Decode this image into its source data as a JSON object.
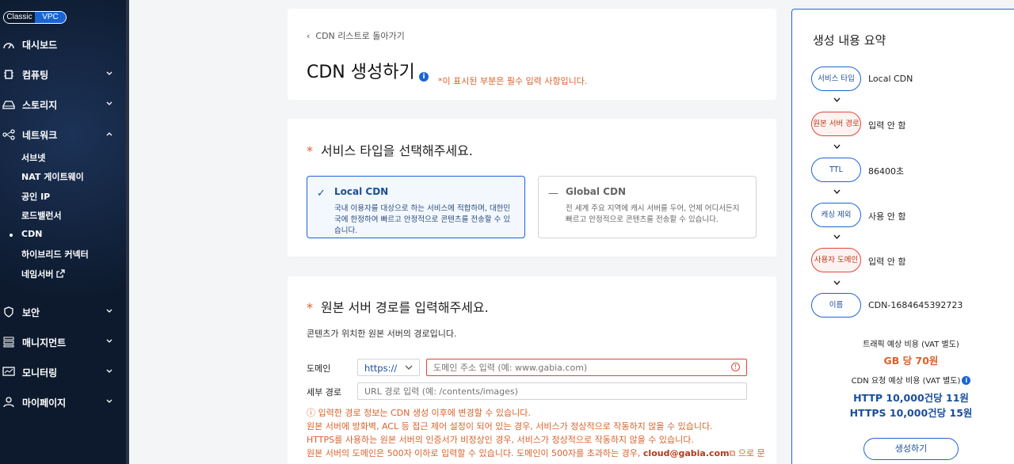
{
  "sidebar": {
    "toggle": {
      "classic": "Classic",
      "vpc": "VPC"
    },
    "menu": [
      {
        "label": "대시보드",
        "icon": "dashboard-icon"
      },
      {
        "label": "컴퓨팅",
        "icon": "chip-icon"
      },
      {
        "label": "스토리지",
        "icon": "storage-icon"
      },
      {
        "label": "네트워크",
        "icon": "network-icon"
      },
      {
        "label": "보안",
        "icon": "shield-icon"
      },
      {
        "label": "매니지먼트",
        "icon": "management-icon"
      },
      {
        "label": "모니터링",
        "icon": "monitor-icon"
      },
      {
        "label": "마이페이지",
        "icon": "user-icon"
      }
    ],
    "network_sub": [
      "서브넷",
      "NAT 게이트웨이",
      "공인 IP",
      "로드밸런서",
      "CDN",
      "하이브리드 커넥터",
      "네임서버"
    ]
  },
  "header": {
    "back_label": "CDN 리스트로 돌아가기",
    "title": "CDN 생성하기",
    "required_note": "*이 표시된 부분은 필수 입력 사항입니다."
  },
  "service_type": {
    "required_mark": "*",
    "title": "서비스 타입을 선택해주세요.",
    "options": [
      {
        "name": "Local CDN",
        "desc": "국내 이용자를 대상으로 하는 서비스에 적합하며, 대한민국에 한정하여 빠르고 안정적으로 콘텐츠를 전송할 수 있습니다.",
        "selected": true
      },
      {
        "name": "Global CDN",
        "desc": "전 세계 주요 지역에 캐시 서버를 두어, 언제 어디서든지 빠르고 안정적으로 콘텐츠를 전송할 수 있습니다.",
        "selected": false
      }
    ]
  },
  "origin": {
    "required_mark": "*",
    "title": "원본 서버 경로를 입력해주세요.",
    "desc": "콘텐츠가 위치한 원본 서버의 경로입니다.",
    "domain_label": "도메인",
    "protocol": "https://",
    "domain_placeholder": "도메인 주소 입력 (예: www.gabia.com)",
    "path_label": "세부 경로",
    "path_placeholder": "URL 경로 입력 (예: /contents/images)",
    "warnings": [
      "입력한 경로 정보는 CDN 생성 이후에 변경할 수 있습니다.",
      "원본 서버에 방화벽, ACL 등 접근 제어 설정이 되어 있는 경우, 서비스가 정상적으로 작동하지 않을 수 있습니다.",
      "HTTPS를 사용하는 원본 서버의 인증서가 비정상인 경우, 서비스가 정상적으로 작동하지 않을 수 있습니다.",
      "원본 서버의 도메인은 500자 이하로 입력할 수 있습니다. 도메인이 500자를 초과하는 경우,",
      "cloud@gabia.com",
      "으로 문"
    ]
  },
  "summary": {
    "title": "생성 내용 요약",
    "items": [
      {
        "label": "서비스 타입",
        "value": "Local CDN",
        "status": "ok"
      },
      {
        "label": "원본 서버 경로",
        "value": "입력 안 함",
        "status": "error"
      },
      {
        "label": "TTL",
        "value": "86400초",
        "status": "ok"
      },
      {
        "label": "캐싱 제외",
        "value": "사용 안 함",
        "status": "ok"
      },
      {
        "label": "사용자 도메인",
        "value": "입력 안 함",
        "status": "error"
      },
      {
        "label": "이름",
        "value": "CDN-1684645392723",
        "status": "ok"
      }
    ],
    "traffic_label": "트래픽 예상 비용 (VAT 별도)",
    "traffic_value": "GB 당 70원",
    "request_label": "CDN 요청 예상 비용 (VAT 별도)",
    "http_value": "HTTP 10,000건당 11원",
    "https_value": "HTTPS 10,000건당 15원",
    "create_label": "생성하기"
  },
  "colors": {
    "accent": "#1a64d6",
    "warning": "#d9622b",
    "error": "#e0453a",
    "sidebar": "#0d1a2e"
  }
}
